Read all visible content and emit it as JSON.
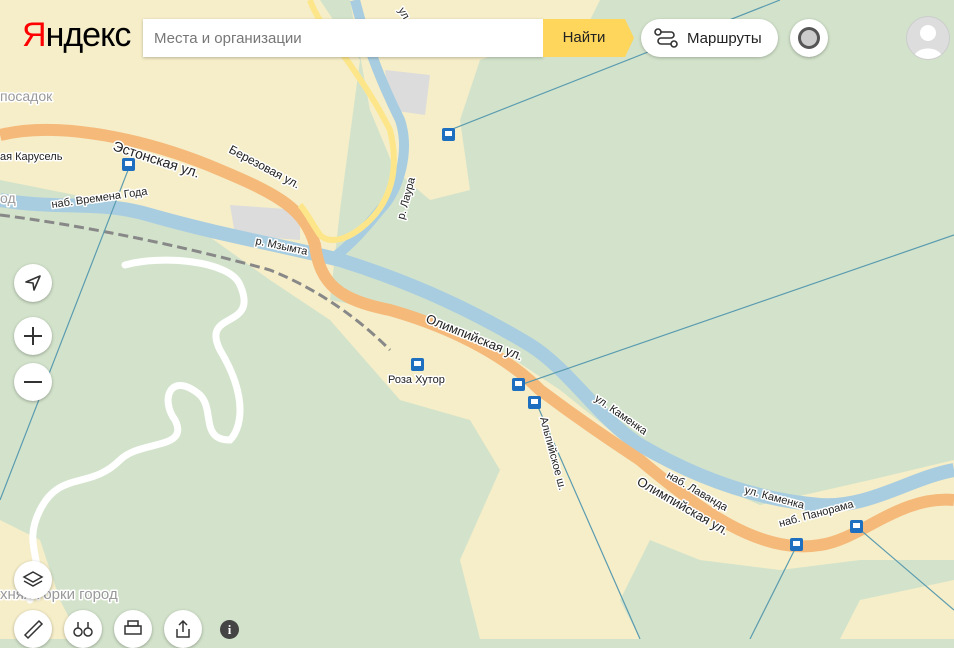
{
  "header": {
    "logo_y": "Я",
    "logo_rest": "ндекс",
    "search_placeholder": "Места и организации",
    "search_value": "",
    "find_label": "Найти",
    "routes_label": "Маршруты"
  },
  "map": {
    "labels": {
      "estonskaya": "Эстонская ул.",
      "berezovaya": "Березовая ул.",
      "karusel": "ая Карусель",
      "posadok": "посадок",
      "vremena_goda": "наб. Времена Года",
      "god": "од",
      "mzymta": "р. Мзымта",
      "laura": "р. Лаура",
      "olimp1": "Олимпийская ул.",
      "olimp2": "Олимпийская ул.",
      "roza_hutor": "Роза Хутор",
      "alpiyskoe": "Альпийское ш.",
      "kamenka1": "ул. Каменка",
      "kamenka2": "ул. Каменка",
      "lavanda": "наб. Лаванда",
      "panorama": "наб. Панорама",
      "gorki": "хняя Горки город",
      "top_ul": "ул."
    }
  },
  "controls": {
    "info_label": "i"
  },
  "colors": {
    "forest": "#d3e3cb",
    "urban": "#f6eec8",
    "main_road": "#f5b97a",
    "river": "#a9cde0",
    "yandex_red": "#ff0000",
    "find_yellow": "#fdd65b"
  }
}
